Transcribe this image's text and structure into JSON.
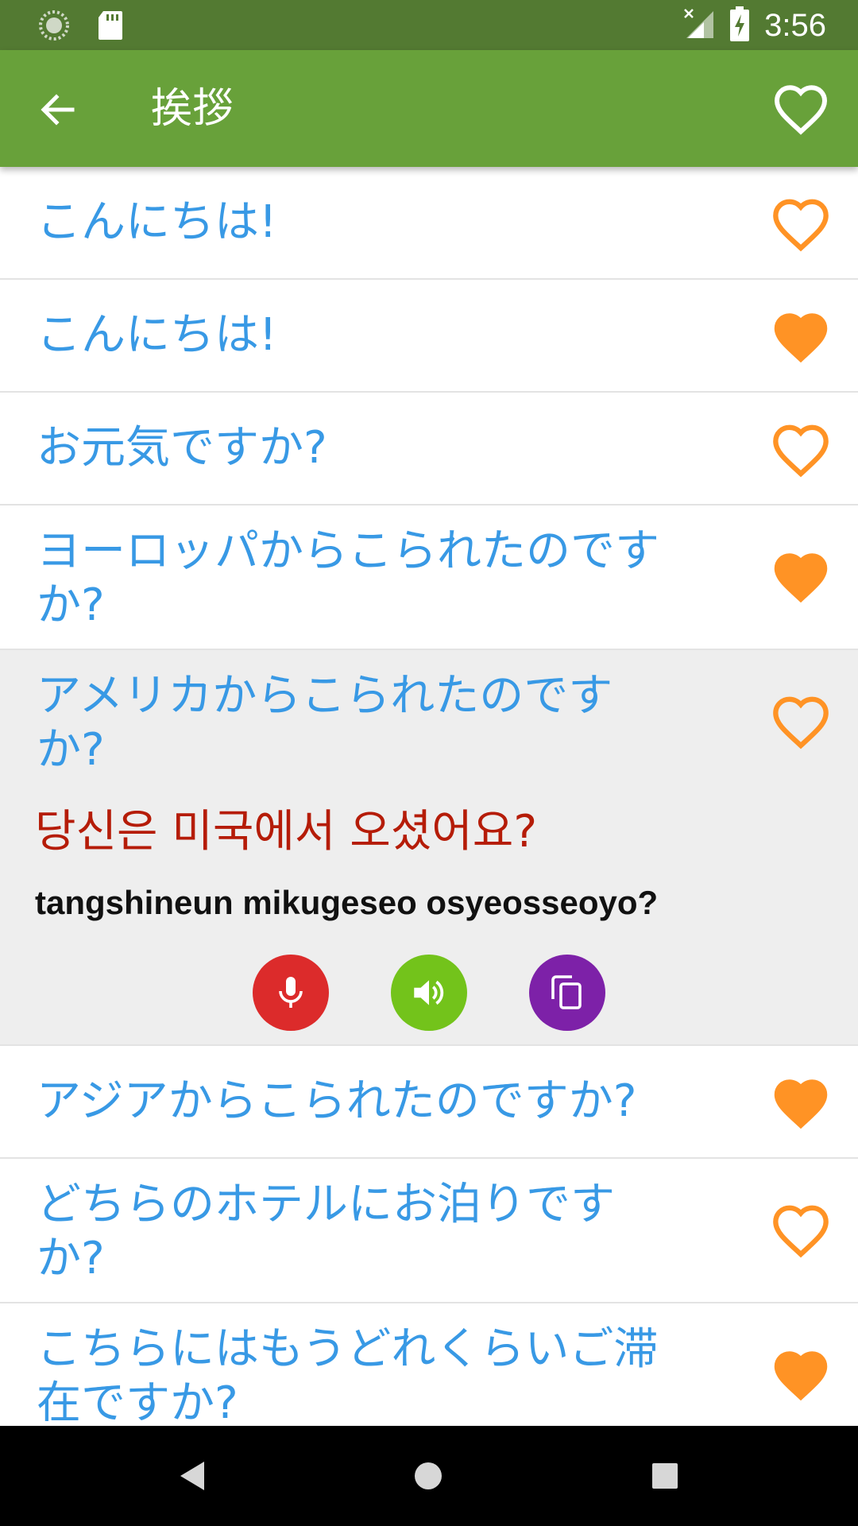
{
  "status_bar": {
    "time": "3:56",
    "left_icons": [
      "sync-icon",
      "sd-card-icon"
    ],
    "right_icons": [
      "signal-off-icon",
      "battery-charging-icon"
    ]
  },
  "toolbar": {
    "title": "挨拶",
    "back_icon": "arrow-back-icon",
    "favorite_icon": "heart-outline-icon"
  },
  "phrases": [
    {
      "text": "こんにちは!",
      "favorite": false
    },
    {
      "text": "こんにちは!",
      "favorite": true
    },
    {
      "text": "お元気ですか?",
      "favorite": false
    },
    {
      "text": "ヨーロッパからこられたのですか?",
      "favorite": true
    },
    {
      "text": "アメリカからこられたのですか?",
      "favorite": false,
      "expanded": true,
      "translation": "당신은 미국에서 오셨어요?",
      "romanization": "tangshineun mikugeseo osyeosseoyo?"
    },
    {
      "text": "アジアからこられたのですか?",
      "favorite": true
    },
    {
      "text": "どちらのホテルにお泊りですか?",
      "favorite": false
    },
    {
      "text": "こちらにはもうどれくらいご滞在ですか?",
      "favorite": true
    }
  ],
  "actions": {
    "record_icon": "microphone-icon",
    "play_icon": "speaker-icon",
    "copy_icon": "copy-icon"
  },
  "colors": {
    "status_bar": "#537a32",
    "toolbar": "#68a13a",
    "phrase_text": "#3899e5",
    "translation_text": "#b51c08",
    "heart": "#ff9325",
    "mic_button": "#dc2b2b",
    "speaker_button": "#73c31b",
    "copy_button": "#7d21a8"
  },
  "nav_bar": {
    "back_icon": "nav-back-icon",
    "home_icon": "nav-home-icon",
    "recents_icon": "nav-recents-icon"
  }
}
